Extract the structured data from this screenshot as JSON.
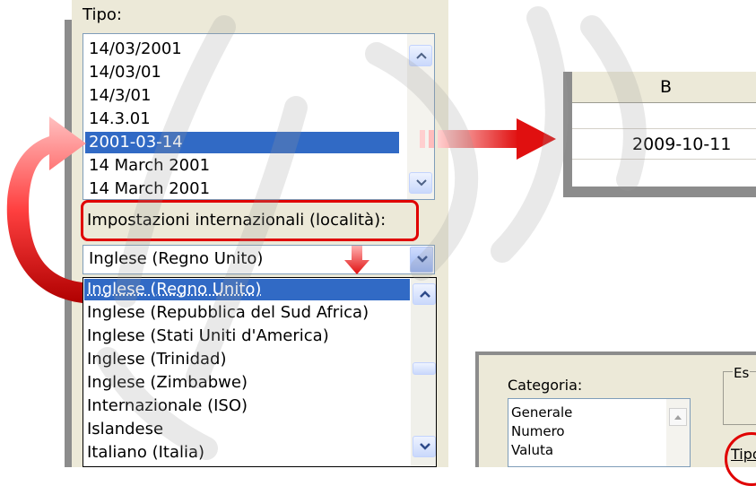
{
  "tipo": {
    "label": "Tipo:",
    "items": [
      "14/03/2001",
      "14/03/01",
      "14/3/01",
      "14.3.01",
      "2001-03-14",
      "14 March 2001",
      "14 March 2001"
    ],
    "selected_index": 4
  },
  "locale": {
    "label": "Impostazioni internazionali (località):",
    "selected": "Inglese (Regno Unito)",
    "dropdown_items": [
      "Inglese (Regno Unito)",
      "Inglese (Repubblica del Sud Africa)",
      "Inglese (Stati Uniti d'America)",
      "Inglese (Trinidad)",
      "Inglese (Zimbabwe)",
      "Internazionale (ISO)",
      "Islandese",
      "Italiano (Italia)"
    ],
    "dropdown_selected_index": 0
  },
  "sheet": {
    "column_header": "B",
    "cell_value": "2009-10-11"
  },
  "format_dialog": {
    "categoria_label": "Categoria:",
    "categories": [
      "Generale",
      "Numero",
      "Valuta"
    ],
    "esempio_fragment": "Es",
    "tipo_fragment": "Tipo"
  },
  "colors": {
    "selection": "#316ac5",
    "dialog_bg": "#ece9d8",
    "arrow_red": "#e01010",
    "highlight_red": "#e00000"
  }
}
